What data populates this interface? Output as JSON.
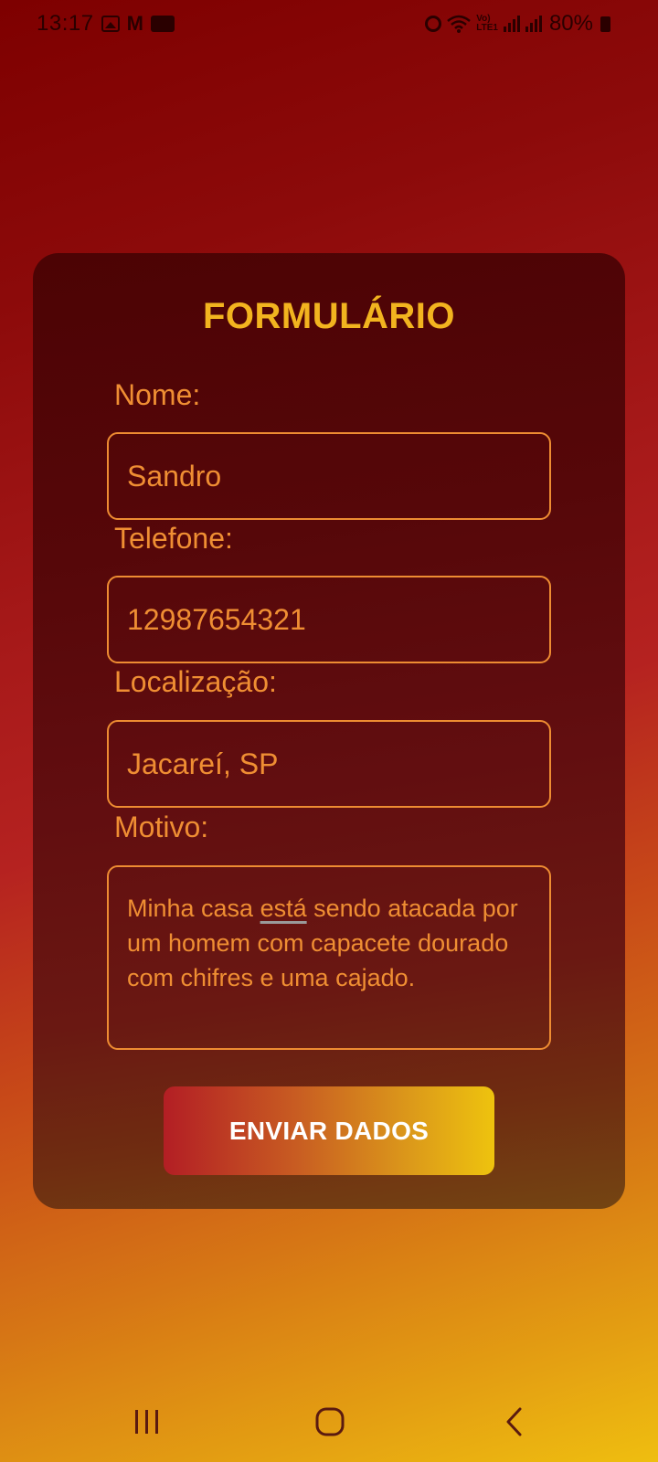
{
  "status_bar": {
    "time": "13:17",
    "battery": "80%",
    "volte_top": "Vo)",
    "volte_bottom": "LTE1",
    "icons": [
      "photo-icon",
      "gmail-icon",
      "camera-app-icon",
      "alarm-icon",
      "wifi-icon",
      "volte-icon",
      "signal-icon",
      "battery-icon"
    ]
  },
  "form": {
    "title": "FORMULÁRIO",
    "fields": {
      "nome": {
        "label": "Nome:",
        "value": "Sandro"
      },
      "telefone": {
        "label": "Telefone:",
        "value": "12987654321"
      },
      "localizacao": {
        "label": "Localização:",
        "value": "Jacareí, SP"
      },
      "motivo": {
        "label": "Motivo:",
        "value_before": "Minha casa ",
        "value_underlined": "está",
        "value_after": " sendo atacada por um homem com capacete dourado com chifres e uma cajado."
      }
    },
    "submit_label": "ENVIAR DADOS"
  },
  "nav_bar": {
    "buttons": [
      "recent-apps",
      "home",
      "back"
    ]
  },
  "colors": {
    "title": "#f2b41f",
    "text": "#ef8e33",
    "border": "#ee8c32",
    "button_start": "#b31e24",
    "button_end": "#eec30e"
  }
}
